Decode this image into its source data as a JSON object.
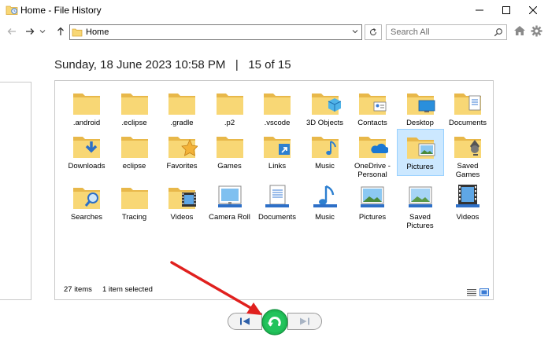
{
  "window": {
    "title": "Home - File History"
  },
  "navigation": {
    "address": "Home",
    "search_placeholder": "Search All"
  },
  "backup": {
    "date": "Sunday, 18 June 2023 10:58 PM",
    "separator": "|",
    "position": "15 of 15"
  },
  "items": [
    {
      "label": ".android",
      "icon": "folder-icon"
    },
    {
      "label": ".eclipse",
      "icon": "folder-icon"
    },
    {
      "label": ".gradle",
      "icon": "folder-icon"
    },
    {
      "label": ".p2",
      "icon": "folder-icon"
    },
    {
      "label": ".vscode",
      "icon": "folder-icon"
    },
    {
      "label": "3D Objects",
      "icon": "3d-objects-folder-icon"
    },
    {
      "label": "Contacts",
      "icon": "contacts-folder-icon"
    },
    {
      "label": "Desktop",
      "icon": "desktop-folder-icon"
    },
    {
      "label": "Documents",
      "icon": "documents-folder-icon"
    },
    {
      "label": "Downloads",
      "icon": "downloads-folder-icon"
    },
    {
      "label": "eclipse",
      "icon": "folder-icon"
    },
    {
      "label": "Favorites",
      "icon": "favorites-folder-icon"
    },
    {
      "label": "Games",
      "icon": "folder-icon"
    },
    {
      "label": "Links",
      "icon": "links-folder-icon"
    },
    {
      "label": "Music",
      "icon": "music-folder-icon"
    },
    {
      "label": "OneDrive - Personal",
      "icon": "onedrive-folder-icon"
    },
    {
      "label": "Pictures",
      "icon": "pictures-folder-icon",
      "selected": true
    },
    {
      "label": "Saved Games",
      "icon": "saved-games-folder-icon"
    },
    {
      "label": "Searches",
      "icon": "searches-folder-icon"
    },
    {
      "label": "Tracing",
      "icon": "folder-icon"
    },
    {
      "label": "Videos",
      "icon": "videos-folder-icon"
    },
    {
      "label": "Camera Roll",
      "icon": "camera-roll-library-icon"
    },
    {
      "label": "Documents",
      "icon": "documents-library-icon"
    },
    {
      "label": "Music",
      "icon": "music-library-icon"
    },
    {
      "label": "Pictures",
      "icon": "pictures-library-icon"
    },
    {
      "label": "Saved Pictures",
      "icon": "saved-pictures-library-icon"
    },
    {
      "label": "Videos",
      "icon": "videos-library-icon"
    }
  ],
  "status": {
    "item_count": "27 items",
    "selection": "1 item selected"
  },
  "colors": {
    "folder": "#f8d775",
    "folder_dark": "#e8b84a",
    "selection": "#cce8ff",
    "restore_button": "#1db954",
    "annotation_arrow": "#e0201e"
  }
}
